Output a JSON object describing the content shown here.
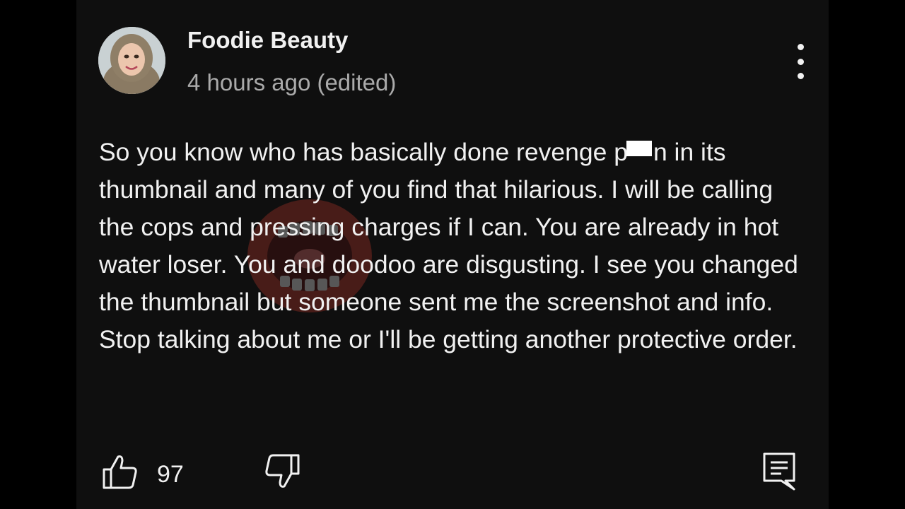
{
  "comment": {
    "author": "Foodie Beauty",
    "timestamp": "4 hours ago (edited)",
    "text_before_redaction": "So you know who has basically done revenge p",
    "text_after_redaction": "n in its thumbnail and many of you find that hilarious. I will be calling the cops and pressing charges if I can. You are already in hot water loser. You and doodoo are disgusting. I see you changed the thumbnail but someone sent me the screenshot and info. Stop talking about me or I'll be getting another protective order.",
    "like_count": "97"
  },
  "icons": {
    "avatar": "avatar-icon",
    "menu": "more-vertical-icon",
    "like": "thumbs-up-icon",
    "dislike": "thumbs-down-icon",
    "reply": "reply-icon",
    "watermark": "mouth-logo-icon"
  },
  "colors": {
    "background": "#0f0f0f",
    "text_primary": "#f1f1f1",
    "text_secondary": "#aaaaaa",
    "watermark": "#c0392b"
  }
}
